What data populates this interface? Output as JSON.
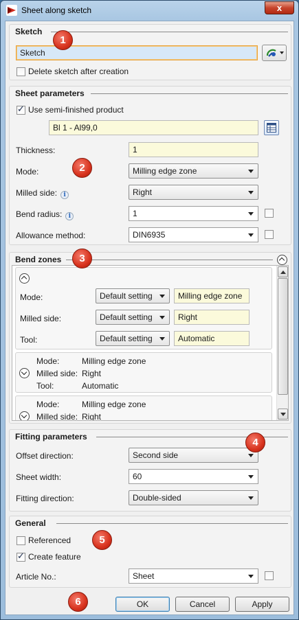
{
  "window": {
    "title": "Sheet along sketch",
    "close_label": "x"
  },
  "sketch": {
    "heading": "Sketch",
    "field_value": "Sketch",
    "delete_label": "Delete sketch after creation",
    "delete_checked": false
  },
  "sheet_params": {
    "heading": "Sheet parameters",
    "semi_label": "Use semi-finished product",
    "semi_checked": true,
    "semi_value": "Bl 1 - Al99,0",
    "thickness_label": "Thickness:",
    "thickness_value": "1",
    "mode_label": "Mode:",
    "mode_value": "Milling edge zone",
    "milled_label": "Milled side:",
    "milled_value": "Right",
    "bend_label": "Bend radius:",
    "bend_value": "1",
    "allowance_label": "Allowance method:",
    "allowance_value": "DIN6935",
    "info_glyph": "i"
  },
  "bend_zones": {
    "heading": "Bend zones",
    "rows": [
      {
        "label": "Mode:",
        "setting": "Default setting",
        "value": "Milling edge zone"
      },
      {
        "label": "Milled side:",
        "setting": "Default setting",
        "value": "Right"
      },
      {
        "label": "Tool:",
        "setting": "Default setting",
        "value": "Automatic"
      }
    ],
    "summary1": {
      "mode_label": "Mode:",
      "mode_value": "Milling edge zone",
      "milled_label": "Milled side:",
      "milled_value": "Right",
      "tool_label": "Tool:",
      "tool_value": "Automatic"
    },
    "summary2": {
      "mode_label": "Mode:",
      "mode_value": "Milling edge zone",
      "milled_label": "Milled side:",
      "milled_value": "Right"
    }
  },
  "fitting": {
    "heading": "Fitting parameters",
    "offset_label": "Offset direction:",
    "offset_value": "Second side",
    "width_label": "Sheet width:",
    "width_value": "60",
    "direction_label": "Fitting direction:",
    "direction_value": "Double-sided"
  },
  "general": {
    "heading": "General",
    "referenced_label": "Referenced",
    "referenced_checked": false,
    "create_label": "Create feature",
    "create_checked": true,
    "article_label": "Article No.:",
    "article_value": "Sheet"
  },
  "buttons": {
    "ok": "OK",
    "cancel": "Cancel",
    "apply": "Apply"
  },
  "badges": [
    "1",
    "2",
    "3",
    "4",
    "5",
    "6"
  ]
}
